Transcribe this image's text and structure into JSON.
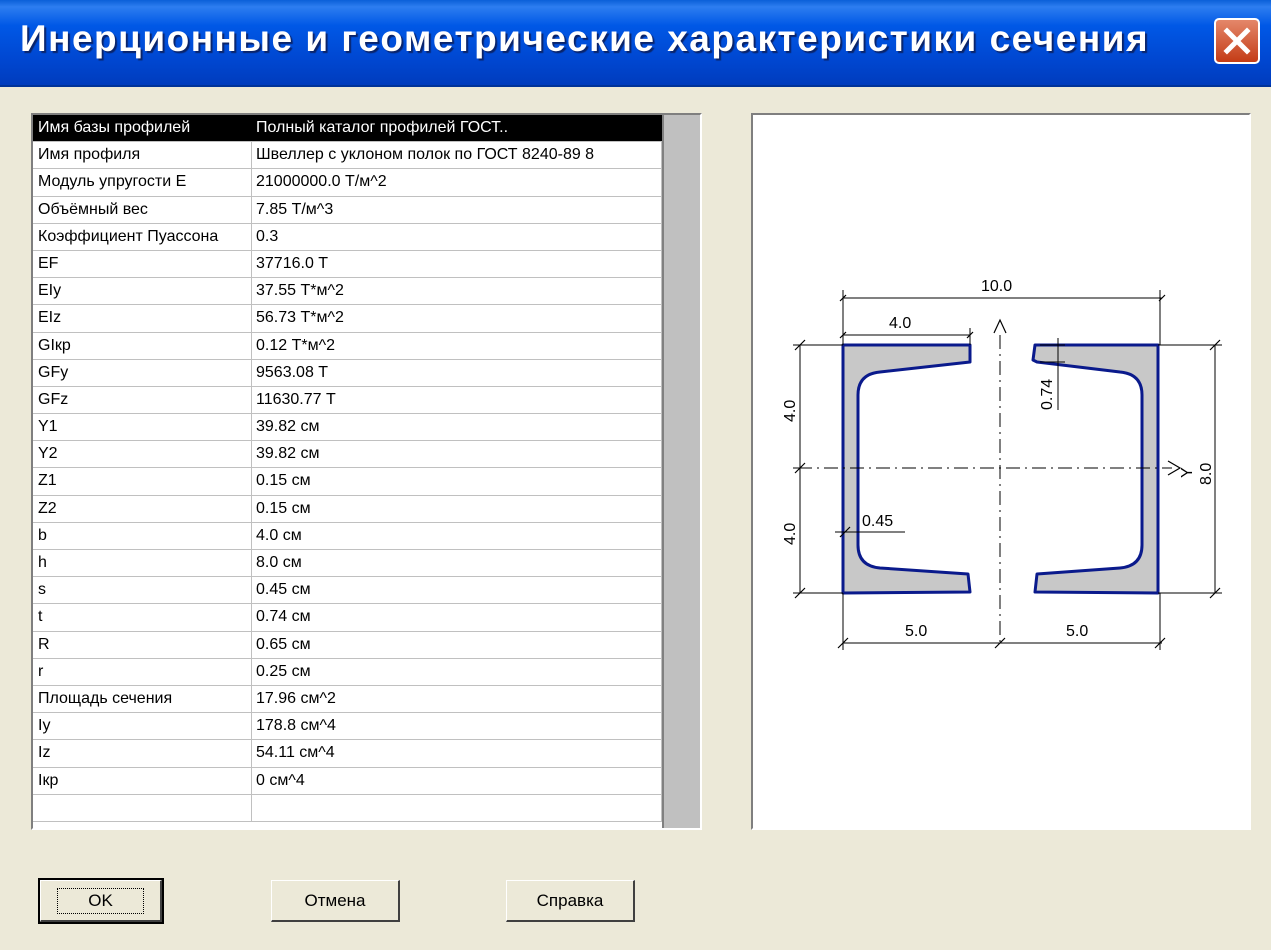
{
  "window": {
    "title": "Инерционные и геометрические характеристики сечения"
  },
  "table": {
    "rows": [
      {
        "name": "Имя базы профилей",
        "value": "Полный каталог профилей ГОСТ.."
      },
      {
        "name": "Имя профиля",
        "value": "Швеллер с уклоном полок по ГОСТ 8240-89 8"
      },
      {
        "name": "Модуль упругости E",
        "value": "21000000.0 Т/м^2"
      },
      {
        "name": "Объёмный вес",
        "value": "7.85 Т/м^3"
      },
      {
        "name": "Коэффициент Пуассона",
        "value": "0.3"
      },
      {
        "name": "EF",
        "value": "37716.0 Т"
      },
      {
        "name": "EIy",
        "value": "37.55 Т*м^2"
      },
      {
        "name": "EIz",
        "value": "56.73 Т*м^2"
      },
      {
        "name": "GIкр",
        "value": "0.12 Т*м^2"
      },
      {
        "name": "GFy",
        "value": "9563.08 Т"
      },
      {
        "name": "GFz",
        "value": "11630.77 Т"
      },
      {
        "name": "Y1",
        "value": "39.82 см"
      },
      {
        "name": "Y2",
        "value": "39.82 см"
      },
      {
        "name": "Z1",
        "value": "0.15 см"
      },
      {
        "name": "Z2",
        "value": "0.15 см"
      },
      {
        "name": "b",
        "value": "4.0 см"
      },
      {
        "name": "h",
        "value": "8.0 см"
      },
      {
        "name": "s",
        "value": "0.45 см"
      },
      {
        "name": "t",
        "value": "0.74 см"
      },
      {
        "name": "R",
        "value": "0.65 см"
      },
      {
        "name": "r",
        "value": "0.25 см"
      },
      {
        "name": "Площадь сечения",
        "value": "17.96 см^2"
      },
      {
        "name": "Iy",
        "value": "178.8 см^4"
      },
      {
        "name": "Iz",
        "value": "54.11 см^4"
      },
      {
        "name": "Iкр",
        "value": "0 см^4"
      },
      {
        "name": "",
        "value": ""
      }
    ]
  },
  "drawing": {
    "dim_total_width": "10.0",
    "dim_flange_width": "4.0",
    "dim_flange_thickness": "0.74",
    "dim_half_height_top": "4.0",
    "dim_half_height_bottom": "4.0",
    "dim_web_thickness": "0.45",
    "dim_height": "8.0",
    "dim_left_half": "5.0",
    "dim_right_half": "5.0",
    "axis_label": "Y"
  },
  "buttons": {
    "ok": "OK",
    "cancel": "Отмена",
    "help": "Справка"
  }
}
